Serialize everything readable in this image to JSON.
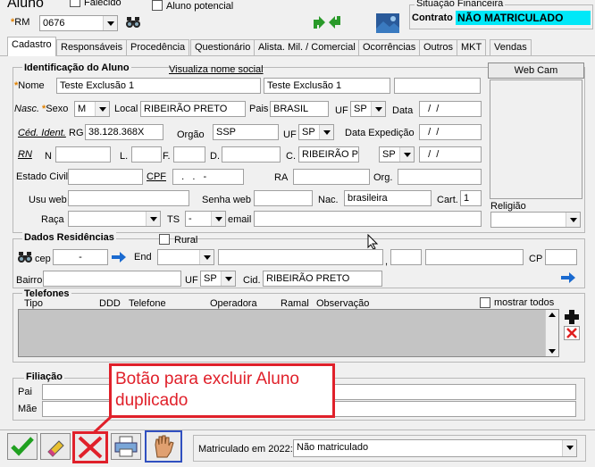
{
  "header": {
    "aluno_label": "Aluno",
    "falecido_label": "Falecido",
    "aluno_potencial_label": "Aluno potencial",
    "rm_label": "RM",
    "rm_value": "0676",
    "situacao_label": "Situação Financeira",
    "contrato_label": "Contrato",
    "contrato_value": "NÃO MATRICULADO"
  },
  "tabs": [
    "Cadastro",
    "Responsáveis",
    "Procedência",
    "Questionário",
    "Alista. Mil. / Comercial",
    "Ocorrências",
    "Outros",
    "MKT",
    "Vendas"
  ],
  "identificacao": {
    "title": "Identificação do Aluno",
    "visualiza_link": "Visualiza nome social",
    "nome_label": "Nome",
    "nome_value": "Teste Exclusão 1",
    "nome_social_value": "Teste Exclusão 1",
    "webcam_label": "Web Cam",
    "nasc_label": "Nasc.",
    "sexo_label": "Sexo",
    "sexo_value": "M",
    "local_label": "Local",
    "local_value": "RIBEIRÃO PRETO",
    "pais_label": "Pais",
    "pais_value": "BRASIL",
    "uf_label": "UF",
    "uf_value": "SP",
    "data_label": "Data",
    "data_value": "  /  /",
    "ced_label": "Céd. Ident.",
    "rg_label": "RG",
    "rg_value": "38.128.368X",
    "orgao_label": "Orgão",
    "orgao_value": "SSP",
    "uf2_value": "SP",
    "data_exp_label": "Data Expedição",
    "data_exp_value": "  /  /",
    "rn_label": "RN",
    "n_label": "N",
    "l_label": "L.",
    "f_label": "F.",
    "d_label": "D.",
    "c_label": "C.",
    "c_value": "RIBEIRÃO PI",
    "uf3_value": "SP",
    "data3_value": "  /  /",
    "estado_civil_label": "Estado Civil",
    "cpf_label": "CPF",
    "cpf_value": "  .   .   -",
    "ra_label": "RA",
    "org_label": "Org.",
    "usu_web_label": "Usu web",
    "senha_web_label": "Senha web",
    "nac_label": "Nac.",
    "nac_value": "brasileira",
    "cart_label": "Cart.",
    "cart_value": "1",
    "religiao_label": "Religião",
    "raca_label": "Raça",
    "ts_label": "TS",
    "ts_value": "-",
    "email_label": "email"
  },
  "residencia": {
    "title": "Dados Residências",
    "rural_label": "Rural",
    "cep_label": "cep",
    "cep_value": "-",
    "end_label": "End",
    "comma": ",",
    "cp_label": "CP",
    "bairro_label": "Bairro",
    "uf_label": "UF",
    "uf_value": "SP",
    "cid_label": "Cid.",
    "cid_value": "RIBEIRÃO PRETO"
  },
  "telefones": {
    "title": "Telefones",
    "mostrar_todos": "mostrar todos",
    "columns": [
      "Tipo",
      "DDD",
      "Telefone",
      "Operadora",
      "Ramal",
      "Observação"
    ]
  },
  "filiacao": {
    "title": "Filiação",
    "pai_label": "Pai",
    "mae_label": "Mãe"
  },
  "annotation": {
    "text": "Botão para excluir Aluno duplicado",
    "color": "#e0202a"
  },
  "footer": {
    "matriculado_label": "Matriculado em 2022:",
    "matriculado_value": "Não matriculado"
  }
}
